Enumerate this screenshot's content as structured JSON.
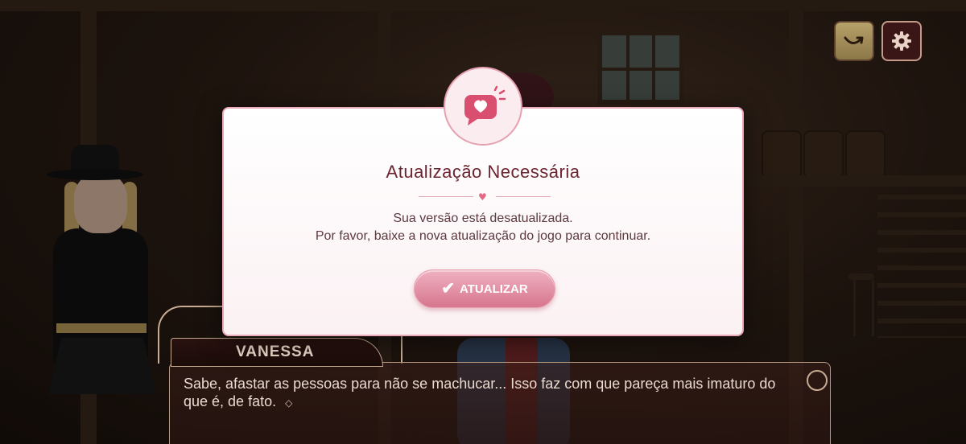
{
  "modal": {
    "title": "Atualização Necessária",
    "line1": "Sua versão está desatualizada.",
    "line2": "Por favor, baixe a nova atualização do jogo para continuar.",
    "button_label": "ATUALIZAR",
    "button_icon": "check-icon",
    "badge_icon": "heart-speech-bubble-icon",
    "divider_icon": "heart-icon",
    "accent_color": "#d7768e",
    "title_color": "#6b2530"
  },
  "dialog": {
    "speaker": "VANESSA",
    "text": "Sabe, afastar as pessoas para não se machucar... Isso faz com que pareça mais imaturo do que é, de fato.",
    "next_indicator": "◇"
  },
  "top_buttons": {
    "skip_icon": "skip-arrow-icon",
    "settings_icon": "gear-icon"
  }
}
